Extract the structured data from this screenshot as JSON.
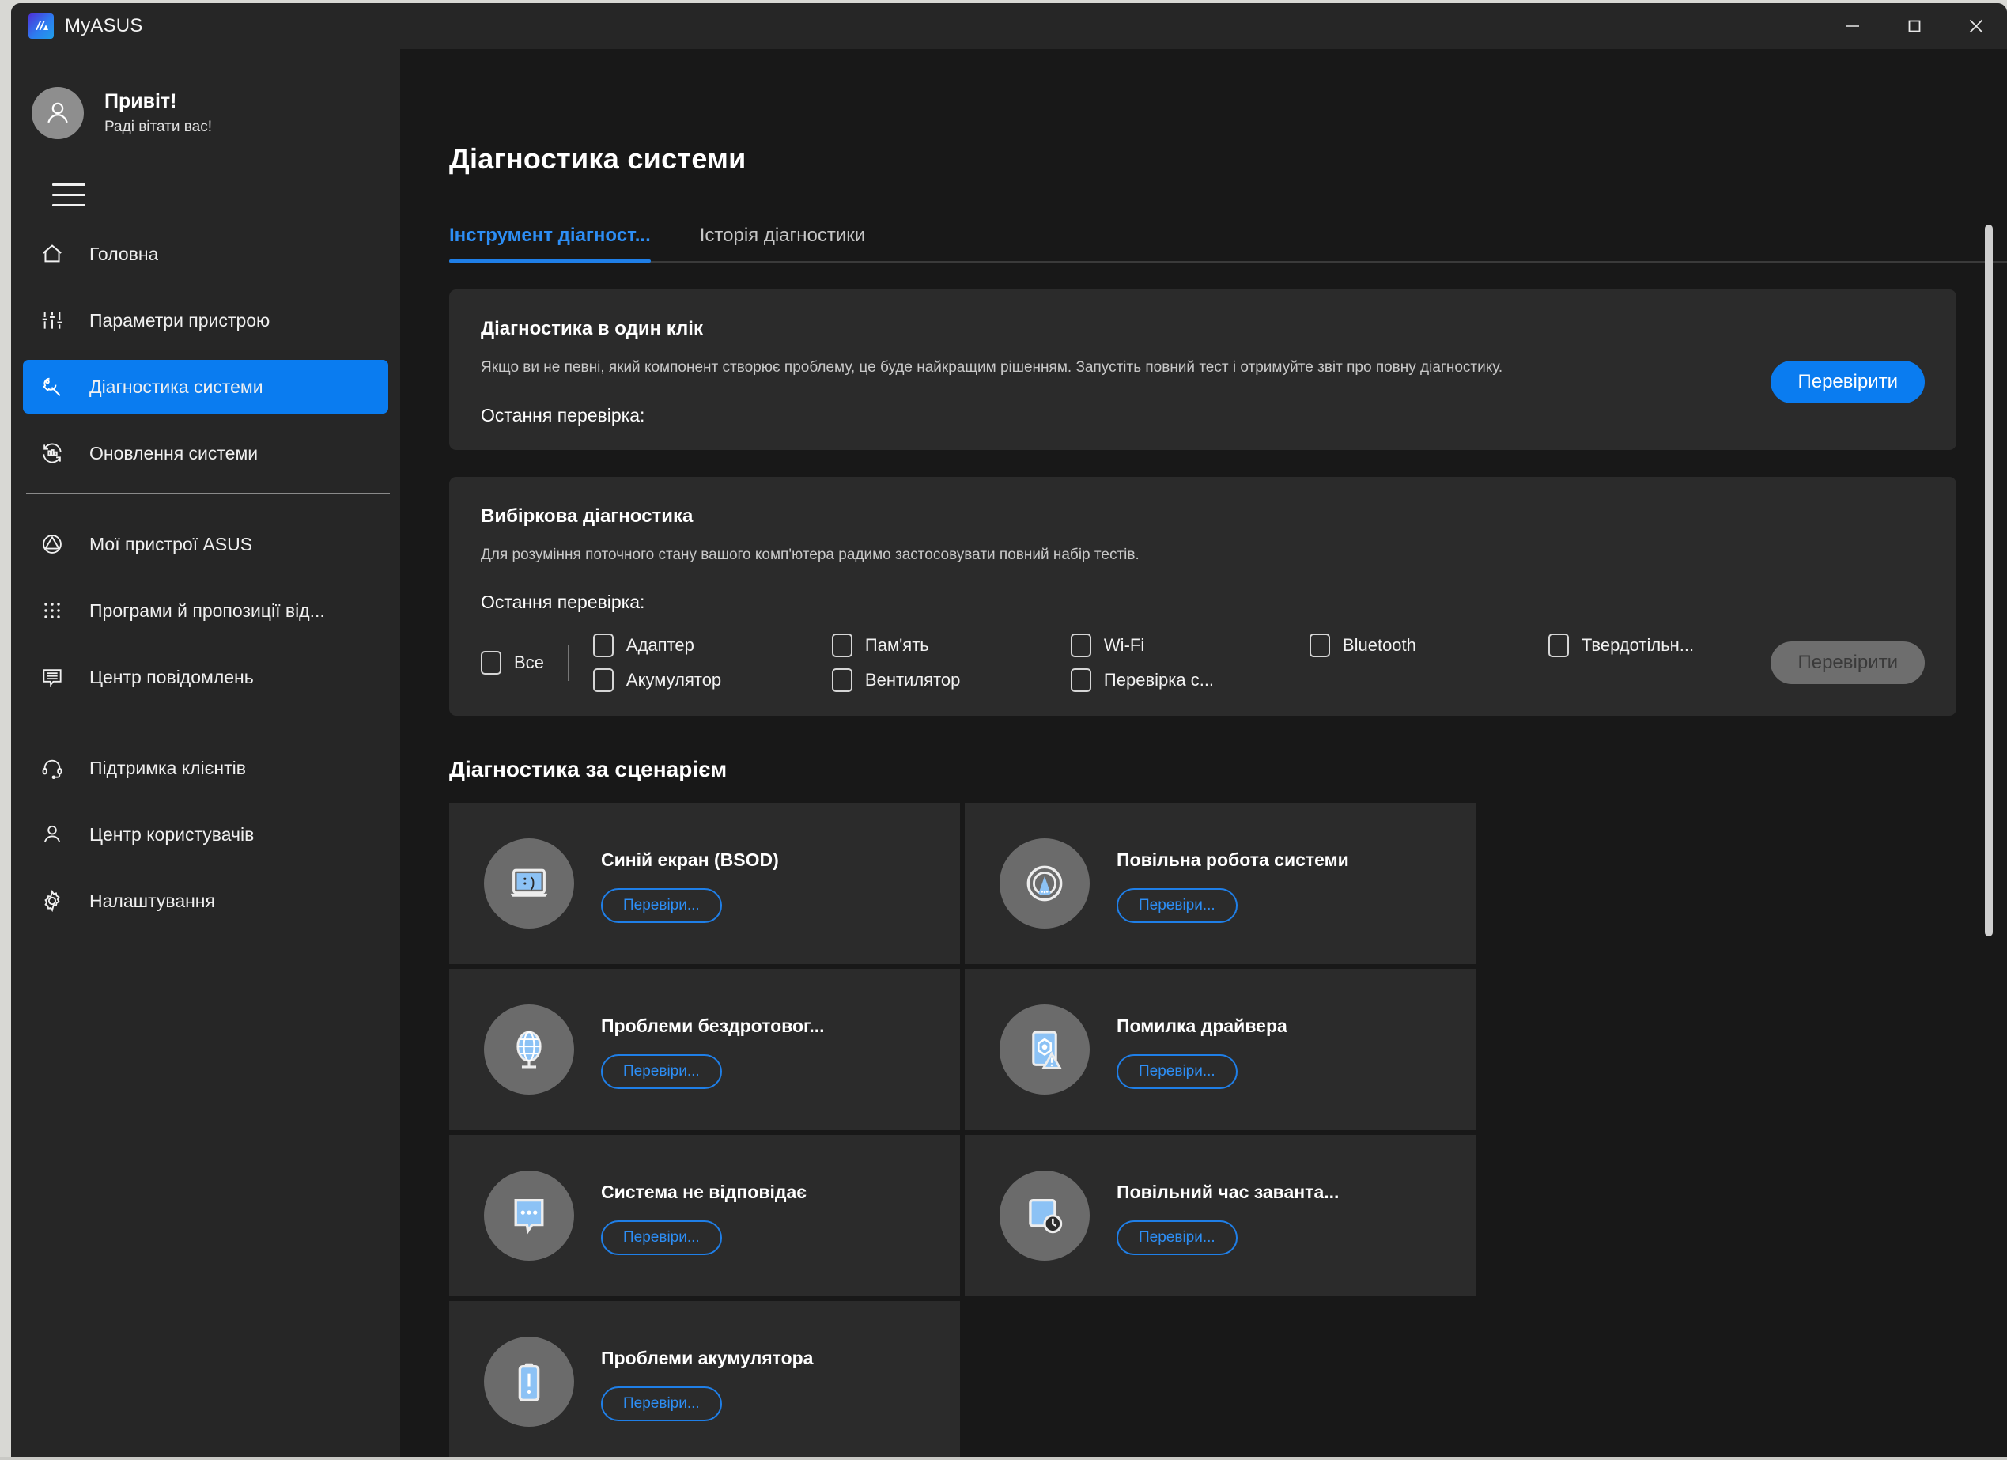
{
  "window": {
    "app_title": "MyASUS",
    "logo_glyph": "//A",
    "controls": {
      "minimize": "minimize-icon",
      "maximize": "maximize-icon",
      "close": "close-icon"
    }
  },
  "sidebar": {
    "greeting": "Привіт!",
    "greeting_sub": "Раді вітати вас!",
    "menu_toggle": "hamburger-icon",
    "groups": [
      {
        "items": [
          {
            "label": "Головна",
            "icon": "home-icon",
            "active": false
          },
          {
            "label": "Параметри пристрою",
            "icon": "sliders-icon",
            "active": false
          },
          {
            "label": "Діагностика системи",
            "icon": "wrench-icon",
            "active": true
          },
          {
            "label": "Оновлення системи",
            "icon": "update-icon",
            "active": false
          }
        ]
      },
      {
        "items": [
          {
            "label": "Мої пристрої ASUS",
            "icon": "asus-devices-icon",
            "active": false
          },
          {
            "label": "Програми й пропозиції від...",
            "icon": "apps-grid-icon",
            "active": false
          },
          {
            "label": "Центр повідомлень",
            "icon": "message-center-icon",
            "active": false
          }
        ]
      },
      {
        "items": [
          {
            "label": "Підтримка клієнтів",
            "icon": "headset-icon",
            "active": false
          },
          {
            "label": "Центр користувачів",
            "icon": "person-icon",
            "active": false
          },
          {
            "label": "Налаштування",
            "icon": "gear-icon",
            "active": false
          }
        ]
      }
    ]
  },
  "main": {
    "page_title": "Діагностика системи",
    "tabs": [
      {
        "label": "Інструмент діагност...",
        "active": true
      },
      {
        "label": "Історія діагностики",
        "active": false
      }
    ],
    "one_click": {
      "title": "Діагностика в один клік",
      "description": "Якщо ви не певні, який компонент створює проблему, це буде найкращим рішенням. Запустіть повний тест і отримуйте звіт про повну діагностику.",
      "last_check_label": "Остання перевірка:",
      "last_check_value": "",
      "button_label": "Перевірити"
    },
    "selective": {
      "title": "Вибіркова діагностика",
      "description": "Для розуміння поточного стану вашого комп'ютера радимо застосовувати повний набір тестів.",
      "last_check_label": "Остання перевірка:",
      "last_check_value": "",
      "button_label": "Перевірити",
      "button_disabled": true,
      "select_all": {
        "label": "Все",
        "checked": false
      },
      "columns": [
        [
          {
            "label": "Адаптер",
            "checked": false
          },
          {
            "label": "Акумулятор",
            "checked": false
          }
        ],
        [
          {
            "label": "Пам'ять",
            "checked": false
          },
          {
            "label": "Вентилятор",
            "checked": false
          }
        ],
        [
          {
            "label": "Wi-Fi",
            "checked": false
          },
          {
            "label": "Перевірка с...",
            "checked": false
          }
        ],
        [
          {
            "label": "Bluetooth",
            "checked": false
          }
        ],
        [
          {
            "label": "Твердотільн...",
            "checked": false
          }
        ]
      ]
    },
    "scenario": {
      "title": "Діагностика за сценарієм",
      "cards": [
        {
          "title": "Синій екран (BSOD)",
          "icon": "laptop-sad-icon",
          "button_label": "Перевіри..."
        },
        {
          "title": "Повільна робота системи",
          "icon": "speedometer-icon",
          "button_label": "Перевіри..."
        },
        {
          "title": "Проблеми бездротовог...",
          "icon": "globe-icon",
          "button_label": "Перевіри..."
        },
        {
          "title": "Помилка драйвера",
          "icon": "driver-warning-icon",
          "button_label": "Перевіри..."
        },
        {
          "title": "Система не відповідає",
          "icon": "chat-dots-icon",
          "button_label": "Перевіри..."
        },
        {
          "title": "Повільний час заванта...",
          "icon": "boot-time-icon",
          "button_label": "Перевіри..."
        },
        {
          "title": "Проблеми акумулятора",
          "icon": "battery-alert-icon",
          "button_label": "Перевіри..."
        }
      ]
    }
  },
  "colors": {
    "accent": "#0a7cf0",
    "accent_text": "#2d8ef5",
    "window_bg": "#262626",
    "main_bg": "#181818",
    "card_bg": "#2b2b2b",
    "icon_circle": "#6b6b6b",
    "icon_blue": "#8cc2f5",
    "disabled_btn": "#6e6e6e"
  }
}
